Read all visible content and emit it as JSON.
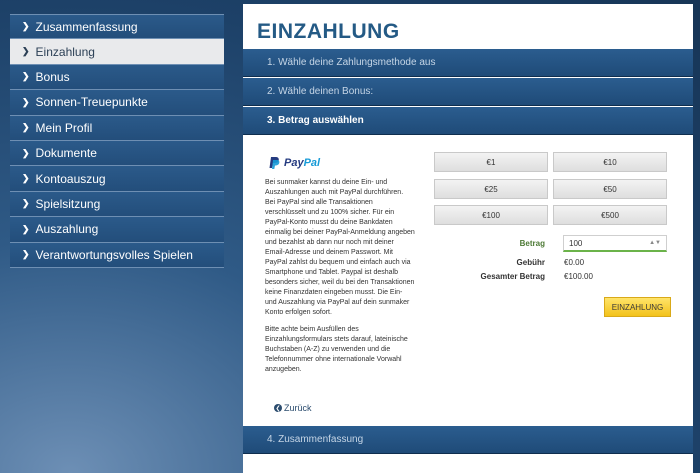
{
  "sidebar": {
    "items": [
      {
        "label": "Zusammenfassung",
        "active": false
      },
      {
        "label": "Einzahlung",
        "active": true
      },
      {
        "label": "Bonus",
        "active": false
      },
      {
        "label": "Sonnen-Treuepunkte",
        "active": false
      },
      {
        "label": "Mein Profil",
        "active": false
      },
      {
        "label": "Dokumente",
        "active": false
      },
      {
        "label": "Kontoauszug",
        "active": false
      },
      {
        "label": "Spielsitzung",
        "active": false
      },
      {
        "label": "Auszahlung",
        "active": false
      },
      {
        "label": "Verantwortungsvolles Spielen",
        "active": false
      }
    ]
  },
  "main": {
    "title": "EINZAHLUNG",
    "steps": [
      {
        "label": "1. Wähle deine Zahlungsmethode aus",
        "active": false
      },
      {
        "label": "2. Wähle deinen Bonus:",
        "active": false
      },
      {
        "label": "3. Betrag auswählen",
        "active": true
      },
      {
        "label": "4. Zusammenfassung",
        "active": false
      }
    ],
    "paypal": {
      "logo_pay": "Pay",
      "logo_pal": "Pal",
      "description_1": "Bei sunmaker kannst du deine Ein- und Auszahlungen auch mit PayPal durchführen. Bei PayPal sind alle Transaktionen verschlüsselt und zu 100% sicher. Für ein PayPal-Konto musst du deine Bankdaten einmalig bei deiner PayPal-Anmeldung angeben und bezahlst ab dann nur noch mit deiner Email-Adresse und deinem Passwort. Mit PayPal zahlst du bequem und einfach auch via Smartphone und Tablet. Paypal ist deshalb besonders sicher, weil du bei den Transaktionen keine Finanzdaten eingeben musst. Die Ein- und Auszahlung via PayPal auf dein sunmaker Konto erfolgen sofort.",
      "description_2": "Bitte achte beim Ausfüllen des Einzahlungsformulars stets darauf, lateinische Buchstaben (A-Z) zu verwenden und die Telefonnummer ohne internationale Vorwahl anzugeben."
    },
    "back_label": "Zurück",
    "amounts": [
      "€1",
      "€10",
      "€25",
      "€50",
      "€100",
      "€500"
    ],
    "betrag_label": "Betrag",
    "betrag_value": "100",
    "gebuehr_label": "Gebühr",
    "gebuehr_value": "€0.00",
    "gesamt_label": "Gesamter Betrag",
    "gesamt_value": "€100.00",
    "submit_label": "EINZAHLUNG"
  },
  "colors": {
    "accent": "#245a85",
    "submit": "#f3c21b",
    "betrag_label": "#4d7a35"
  }
}
